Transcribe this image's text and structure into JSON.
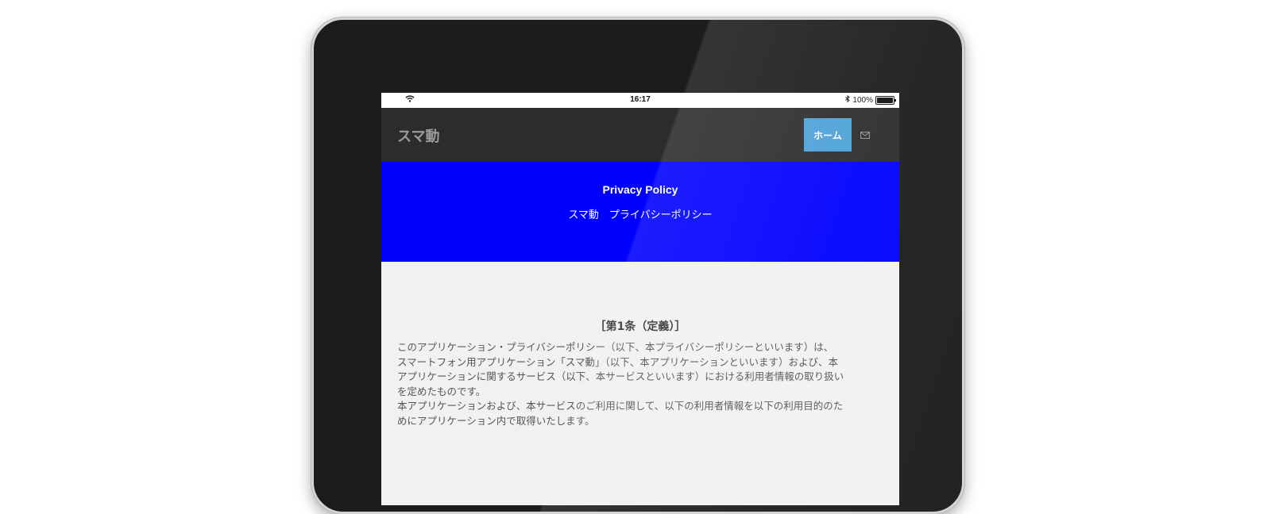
{
  "statusbar": {
    "time": "16:17",
    "battery_level": "100%",
    "battery_fraction": 1.0,
    "icons": [
      "wifi-icon",
      "bluetooth-icon",
      "battery-icon"
    ]
  },
  "navbar": {
    "brand": "スマ動",
    "home_label": "ホーム",
    "contact_icon": "envelope-icon",
    "home_color": "#4ea2d8",
    "background": "#2c2c2c"
  },
  "hero": {
    "title": "Privacy Policy",
    "subtitle": "スマ動　プライバシーポリシー",
    "background": "#0000ff"
  },
  "article": {
    "title": "［第1条（定義）］",
    "lines": [
      "このアプリケーション・プライバシーポリシー（以下、本プライバシーポリシーといいます）は、",
      "スマートフォン用アプリケーション「スマ動」（以下、本アプリケーションといいます）および、本",
      "アプリケーションに関するサービス（以下、本サービスといいます）における利用者情報の取り扱い",
      "を定めたものです。",
      "本アプリケーションおよび、本サービスのご利用に関して、以下の利用者情報を以下の利用目的のた",
      "めにアプリケーション内で取得いたします。"
    ]
  }
}
